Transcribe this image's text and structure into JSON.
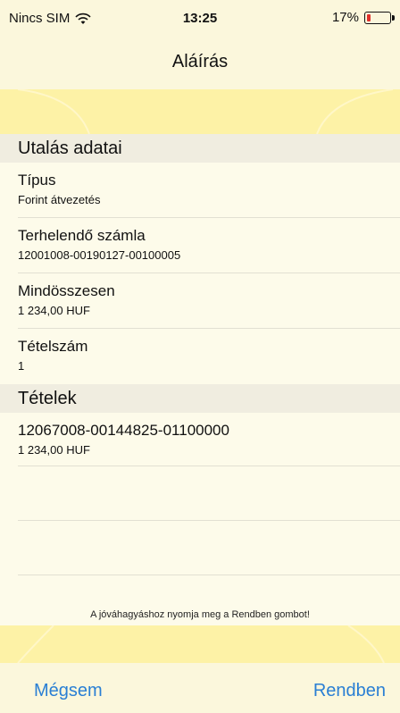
{
  "status_bar": {
    "carrier": "Nincs SIM",
    "time": "13:25",
    "battery": "17%",
    "battery_level": 0.17
  },
  "nav": {
    "title": "Aláírás"
  },
  "sections": {
    "transfer_details": {
      "header": "Utalás adatai",
      "rows": [
        {
          "label": "Típus",
          "value": "Forint átvezetés"
        },
        {
          "label": "Terhelendő számla",
          "value": "12001008-00190127-00100005"
        },
        {
          "label": "Mindösszesen",
          "value": "1 234,00 HUF"
        },
        {
          "label": "Tételszám",
          "value": "1"
        }
      ]
    },
    "items": {
      "header": "Tételek",
      "rows": [
        {
          "label": "12067008-00144825-01100000",
          "value": "1 234,00 HUF"
        }
      ]
    }
  },
  "hint": "A jóváhagyáshoz nyomja meg a Rendben gombot!",
  "toolbar": {
    "cancel_label": "Mégsem",
    "ok_label": "Rendben"
  },
  "colors": {
    "accent": "#2a7fd4",
    "band": "#fdf2a6",
    "background": "#fdfbea",
    "battery_low": "#e0302a"
  }
}
